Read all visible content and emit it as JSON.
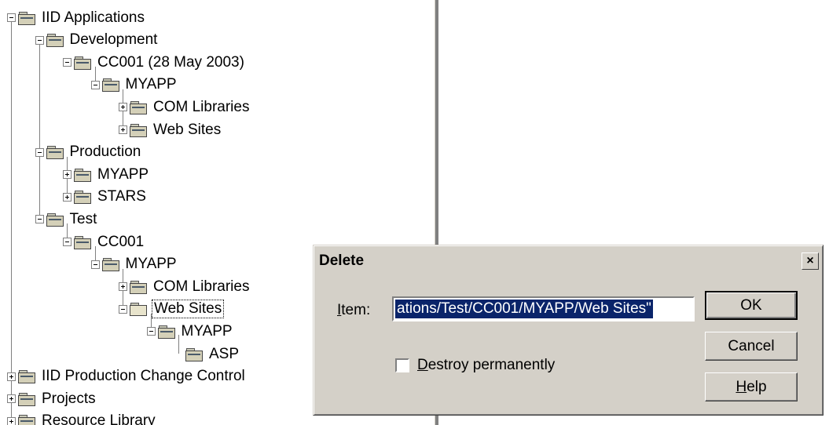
{
  "tree": {
    "nodes": [
      {
        "label": "IID Applications",
        "expander": "minus",
        "level": 0
      },
      {
        "label": "Development",
        "expander": "minus",
        "level": 1
      },
      {
        "label": "CC001 (28 May 2003)",
        "expander": "minus",
        "level": 2
      },
      {
        "label": "MYAPP",
        "expander": "minus",
        "level": 3
      },
      {
        "label": "COM Libraries",
        "expander": "plus",
        "level": 4
      },
      {
        "label": "Web Sites",
        "expander": "plus",
        "level": 4
      },
      {
        "label": "Production",
        "expander": "minus",
        "level": 1
      },
      {
        "label": "MYAPP",
        "expander": "plus",
        "level": 2
      },
      {
        "label": "STARS",
        "expander": "plus",
        "level": 2
      },
      {
        "label": "Test",
        "expander": "minus",
        "level": 1
      },
      {
        "label": "CC001",
        "expander": "minus",
        "level": 2
      },
      {
        "label": "MYAPP",
        "expander": "minus",
        "level": 3
      },
      {
        "label": "COM Libraries",
        "expander": "plus",
        "level": 4
      },
      {
        "label": "Web Sites",
        "expander": "minus",
        "level": 4,
        "selected": true
      },
      {
        "label": "MYAPP",
        "expander": "minus",
        "level": 5
      },
      {
        "label": "ASP",
        "expander": "none",
        "level": 6
      },
      {
        "label": "IID Production Change Control",
        "expander": "plus",
        "level": 0
      },
      {
        "label": "Projects",
        "expander": "plus",
        "level": 0
      },
      {
        "label": "Resource Library",
        "expander": "plus",
        "level": 0
      }
    ]
  },
  "dialog": {
    "title": "Delete",
    "close_glyph": "×",
    "item_label_key": "I",
    "item_label_rest": "tem:",
    "item_value": "ations/Test/CC001/MYAPP/Web Sites\"",
    "checkbox_key": "D",
    "checkbox_rest": "estroy permanently",
    "checkbox_checked": false,
    "ok_label": "OK",
    "cancel_label": "Cancel",
    "help_key": "H",
    "help_rest": "elp"
  }
}
